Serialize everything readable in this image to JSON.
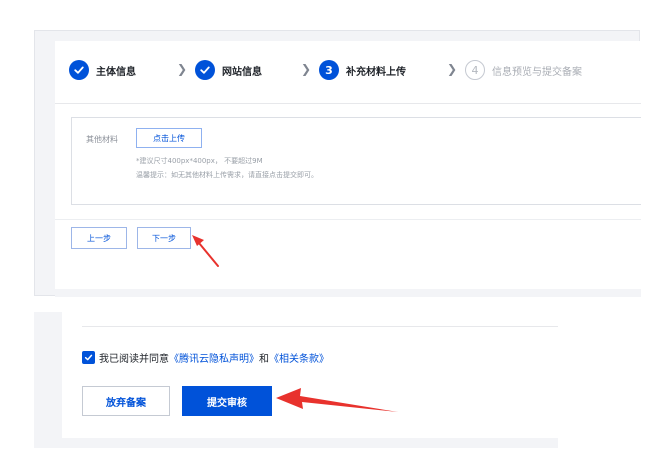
{
  "steps": [
    {
      "label": "主体信息",
      "state": "done"
    },
    {
      "label": "网站信息",
      "state": "done"
    },
    {
      "label": "补充材料上传",
      "state": "active",
      "number": "3"
    },
    {
      "label": "信息预览与提交备案",
      "state": "pending",
      "number": "4"
    }
  ],
  "upload": {
    "field_label": "其他材料",
    "button_label": "点击上传",
    "hint_size": "*建议尺寸400px*400px， 不要超过9M",
    "hint_tip": "温馨提示：如无其他材料上传需求，请直接点击提交即可。"
  },
  "nav": {
    "prev_label": "上一步",
    "next_label": "下一步"
  },
  "agreement": {
    "prefix": "我已阅读并同意",
    "link1": "《腾讯云隐私声明》",
    "conjunction": "和",
    "link2": "《相关条款》",
    "checked": true
  },
  "actions": {
    "abandon_label": "放弃备案",
    "submit_label": "提交审核"
  },
  "colors": {
    "primary": "#0052d9",
    "annotation": "#e8322d"
  }
}
